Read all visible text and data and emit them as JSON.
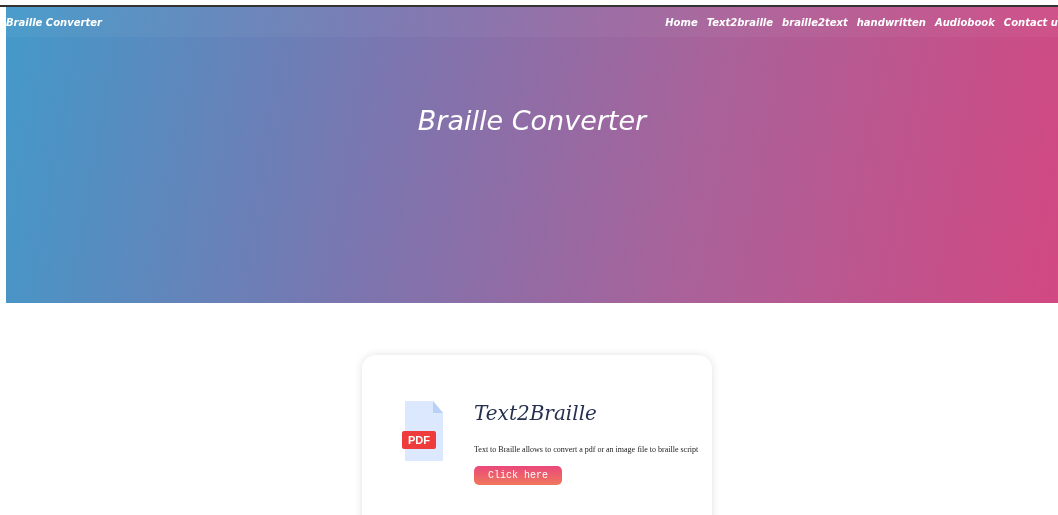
{
  "header": {
    "brand": "Braille Converter",
    "nav": [
      {
        "label": "Home"
      },
      {
        "label": "Text2braille"
      },
      {
        "label": "braille2text"
      },
      {
        "label": "handwritten"
      },
      {
        "label": "Audiobook"
      },
      {
        "label": "Contact u"
      }
    ],
    "title": "Braille Converter"
  },
  "card": {
    "icon_label": "PDF",
    "title": "Text2Braille",
    "description": "Text to Braille allows to convert a pdf or an image file to braille script",
    "button": "Click here"
  }
}
